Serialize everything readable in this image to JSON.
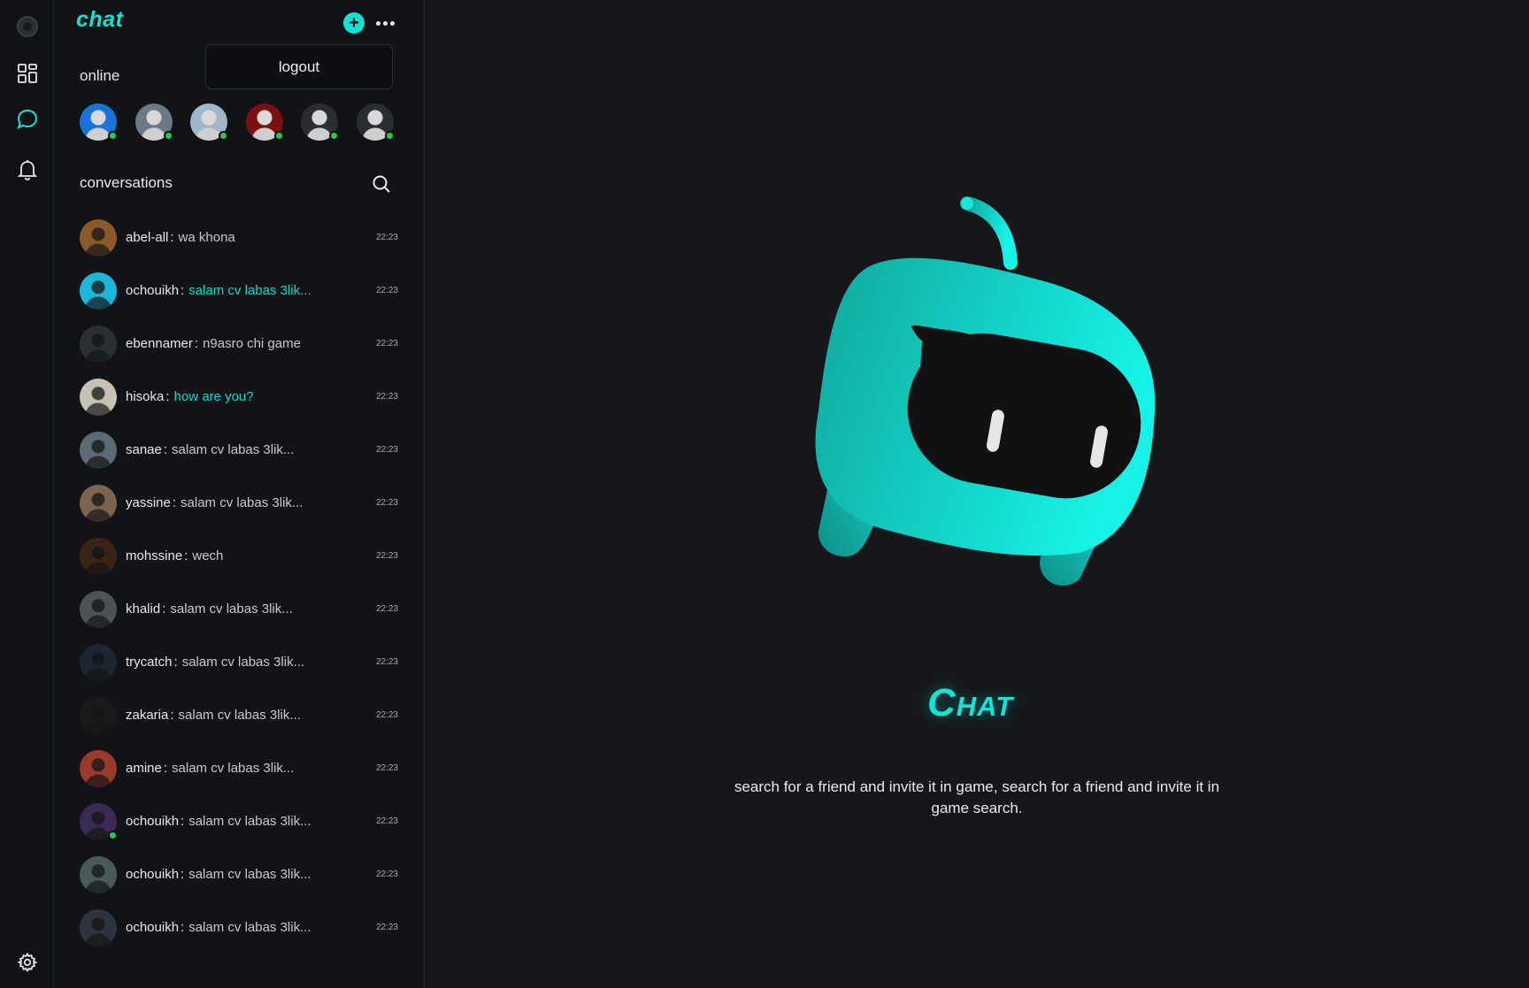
{
  "app": {
    "brand": "chat"
  },
  "header": {
    "logout_label": "logout"
  },
  "online": {
    "label": "online",
    "users": [
      {
        "color": "#1a73d9"
      },
      {
        "color": "#6c7a86"
      },
      {
        "color": "#9fb7c9"
      },
      {
        "color": "#7a1010"
      },
      {
        "color": "#2a2d31"
      },
      {
        "color": "#2a2d31"
      }
    ]
  },
  "conversations": {
    "label": "conversations",
    "items": [
      {
        "name": "abel-all",
        "message": "wa khona",
        "time": "22:23",
        "highlight": false,
        "online": false,
        "color": "#8a5a2b"
      },
      {
        "name": "ochouikh",
        "message": "salam cv labas 3lik...",
        "time": "22:23",
        "highlight": true,
        "online": false,
        "color": "#1cb6d8"
      },
      {
        "name": "ebennamer",
        "message": "n9asro chi game",
        "time": "22:23",
        "highlight": false,
        "online": false,
        "color": "#2b2e32"
      },
      {
        "name": "hisoka",
        "message": "how are you?",
        "time": "22:23",
        "highlight": true,
        "online": false,
        "color": "#c7c2b5"
      },
      {
        "name": "sanae",
        "message": "salam cv labas 3lik...",
        "time": "22:23",
        "highlight": false,
        "online": false,
        "color": "#5c6b73"
      },
      {
        "name": "yassine",
        "message": "salam cv labas 3lik...",
        "time": "22:23",
        "highlight": false,
        "online": false,
        "color": "#7d6450"
      },
      {
        "name": "mohssine",
        "message": "wech",
        "time": "22:23",
        "highlight": false,
        "online": false,
        "color": "#3a2418"
      },
      {
        "name": "khalid",
        "message": "salam cv labas 3lik...",
        "time": "22:23",
        "highlight": false,
        "online": false,
        "color": "#4c5258"
      },
      {
        "name": "trycatch",
        "message": "salam cv labas 3lik...",
        "time": "22:23",
        "highlight": false,
        "online": false,
        "color": "#1c2630"
      },
      {
        "name": "zakaria",
        "message": "salam cv labas 3lik...",
        "time": "22:23",
        "highlight": false,
        "online": false,
        "color": "#1a1a1a"
      },
      {
        "name": "amine",
        "message": "salam cv labas 3lik...",
        "time": "22:23",
        "highlight": false,
        "online": false,
        "color": "#9a3a2a"
      },
      {
        "name": "ochouikh",
        "message": "salam cv labas 3lik...",
        "time": "22:23",
        "highlight": false,
        "online": true,
        "color": "#3a2a55"
      },
      {
        "name": "ochouikh",
        "message": "salam cv labas 3lik...",
        "time": "22:23",
        "highlight": false,
        "online": false,
        "color": "#4a5a5c"
      },
      {
        "name": "ochouikh",
        "message": "salam cv labas 3lik...",
        "time": "22:23",
        "highlight": false,
        "online": false,
        "color": "#2c3440"
      }
    ]
  },
  "main": {
    "title": "Chat",
    "description": "search for a friend and invite it in game, search for a friend and invite it in game search."
  },
  "colors": {
    "accent": "#14e0d4",
    "background": "#15171b",
    "sidebar": "#111317",
    "online_dot": "#25c94f"
  },
  "icons": {
    "rail": [
      "app-logo-icon",
      "dashboard-icon",
      "chat-bubble-icon",
      "bell-icon",
      "settings-gear-icon"
    ],
    "header": [
      "plus-icon",
      "more-dots-icon"
    ],
    "search": "search-icon"
  }
}
